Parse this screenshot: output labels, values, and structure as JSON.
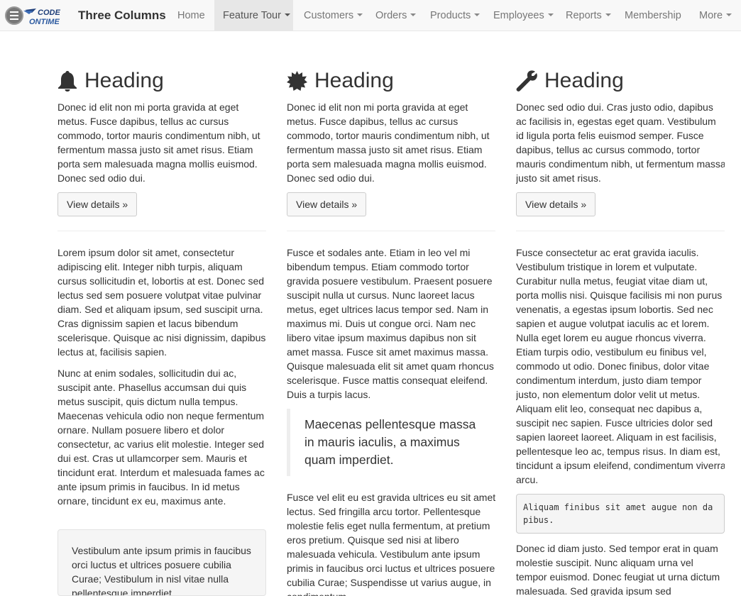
{
  "app": {
    "title": "Three Columns",
    "logo_text_top": "CODE",
    "logo_text_bottom": "ONTIME"
  },
  "nav": {
    "items": [
      {
        "label": "Home",
        "dropdown": false,
        "active": false
      },
      {
        "label": "Feature Tour",
        "dropdown": true,
        "active": true
      },
      {
        "label": "Customers",
        "dropdown": true,
        "active": false
      },
      {
        "label": "Orders",
        "dropdown": true,
        "active": false
      },
      {
        "label": "Products",
        "dropdown": true,
        "active": false
      },
      {
        "label": "Employees",
        "dropdown": true,
        "active": false
      },
      {
        "label": "Reports",
        "dropdown": true,
        "active": false
      },
      {
        "label": "Membership",
        "dropdown": false,
        "active": false
      },
      {
        "label": "More",
        "dropdown": true,
        "active": false
      }
    ]
  },
  "columns": [
    {
      "icon": "bell-icon",
      "heading": "Heading",
      "intro": "Donec id elit non mi porta gravida at eget metus. Fusce dapibus, tellus ac cursus commodo, tortor mauris condimentum nibh, ut fermentum massa justo sit amet risus. Etiam porta sem malesuada magna mollis euismod. Donec sed odio dui.",
      "button": "View details »",
      "para1": "Lorem ipsum dolor sit amet, consectetur adipiscing elit. Integer nibh turpis, aliquam cursus sollicitudin et, lobortis at est. Donec sed lectus sed sem posuere volutpat vitae pulvinar diam. Sed et aliquam ipsum, sed suscipit urna. Cras dignissim sapien et lacus bibendum scelerisque. Quisque ac nisi dignissim, dapibus lectus at, facilisis sapien.",
      "para2": "Nunc at enim sodales, sollicitudin dui ac, suscipit ante. Phasellus accumsan dui quis metus suscipit, quis dictum nulla tempus. Maecenas vehicula odio non neque fermentum ornare. Nullam posuere libero et dolor consectetur, ac varius elit molestie. Integer sed dui est. Cras ut ullamcorper sem. Mauris et tincidunt erat. Interdum et malesuada fames ac ante ipsum primis in faucibus. In id metus ornare, tincidunt ex eu, maximus ante.",
      "well": "Vestibulum ante ipsum primis in faucibus orci luctus et ultrices posuere cubilia Curae; Vestibulum in nisl vitae nulla pellentesque imperdiet"
    },
    {
      "icon": "certificate-icon",
      "heading": "Heading",
      "intro": "Donec id elit non mi porta gravida at eget metus. Fusce dapibus, tellus ac cursus commodo, tortor mauris condimentum nibh, ut fermentum massa justo sit amet risus. Etiam porta sem malesuada magna mollis euismod. Donec sed odio dui.",
      "button": "View details »",
      "para1": "Fusce et sodales ante. Etiam in leo vel mi bibendum tempus. Etiam commodo tortor gravida posuere vestibulum. Praesent posuere suscipit nulla ut cursus. Nunc laoreet lacus metus, eget ultrices lacus tempor sed. Nam in maximus mi. Duis ut congue orci. Nam nec libero vitae ipsum maximus dapibus non sit amet massa. Fusce sit amet maximus massa. Quisque malesuada elit sit amet quam rhoncus scelerisque. Fusce mattis consequat eleifend. Duis a turpis lacus.",
      "quote": "Maecenas pellentesque massa in mauris iaculis, a maximus quam imperdiet.",
      "para2": "Fusce vel elit eu est gravida ultrices eu sit amet lectus. Sed fringilla arcu tortor. Pellentesque molestie felis eget nulla fermentum, at pretium eros pretium. Quisque sed nisi at libero malesuada vehicula. Vestibulum ante ipsum primis in faucibus orci luctus et ultrices posuere cubilia Curae; Suspendisse ut varius augue, in condimentum"
    },
    {
      "icon": "wrench-icon",
      "heading": "Heading",
      "intro": "Donec sed odio dui. Cras justo odio, dapibus ac facilisis in, egestas eget quam. Vestibulum id ligula porta felis euismod semper. Fusce dapibus, tellus ac cursus commodo, tortor mauris condimentum nibh, ut fermentum massa justo sit amet risus.",
      "button": "View details »",
      "para1": "Fusce consectetur ac erat gravida iaculis. Vestibulum tristique in lorem et vulputate. Curabitur nulla metus, feugiat vitae diam ut, porta mollis nisi. Quisque facilisis mi non purus venenatis, a egestas ipsum lobortis. Sed nec sapien et augue volutpat iaculis ac et lorem. Nulla eget lorem eu augue rhoncus viverra. Etiam turpis odio, vestibulum eu finibus vel, commodo ut odio. Donec finibus, dolor vitae condimentum interdum, justo diam tempor justo, non elementum dolor velit ut metus. Aliquam elit leo, consequat nec dapibus a, suscipit nec sapien. Fusce ultricies dolor sed sapien laoreet laoreet. Aliquam in est facilisis, pellentesque leo ac, tempus risus. In diam est, tincidunt a ipsum eleifend, condimentum viverra arcu.",
      "code": "Aliquam finibus sit amet augue non dapibus.",
      "para2": "Donec id diam justo. Sed tempor erat in quam molestie suscipit. Nunc aliquam urna vel tempor euismod. Donec feugiat ut urna dictum malesuada. Sed gravida ipsum sed"
    }
  ]
}
